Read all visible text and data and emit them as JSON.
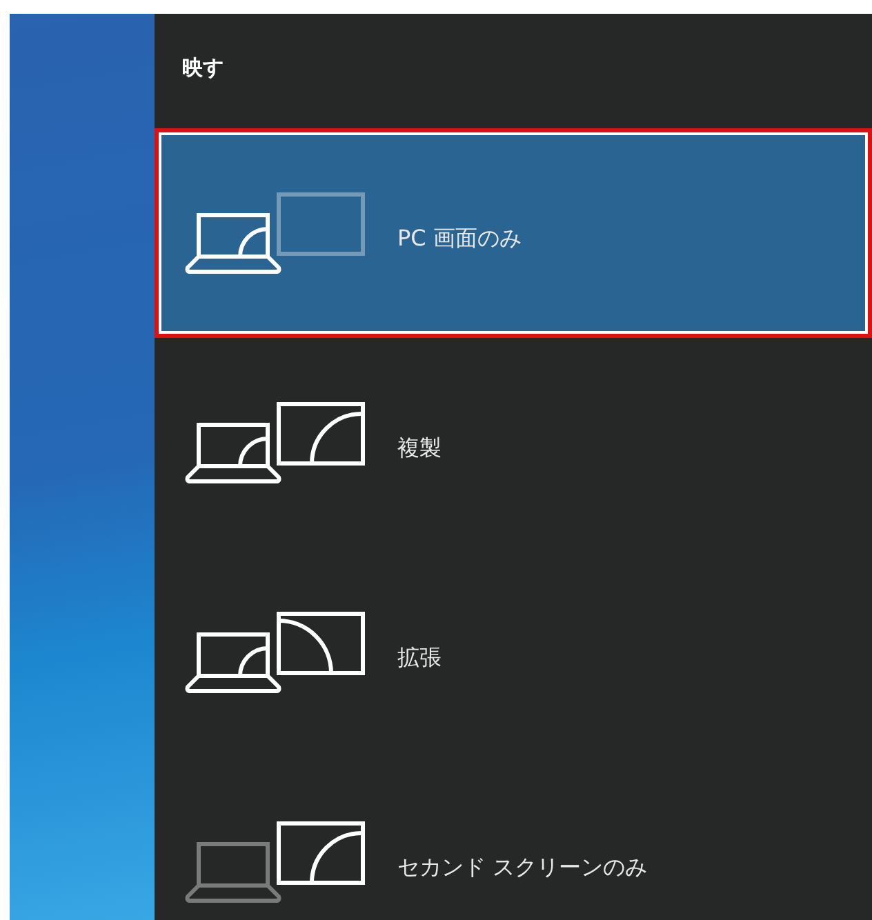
{
  "panel": {
    "title": "映す",
    "options": [
      {
        "label": "PC 画面のみ",
        "kind": "pc_only",
        "selected": true
      },
      {
        "label": "複製",
        "kind": "duplicate",
        "selected": false
      },
      {
        "label": "拡張",
        "kind": "extend",
        "selected": false
      },
      {
        "label": "セカンド スクリーンのみ",
        "kind": "second_only",
        "selected": false
      }
    ]
  }
}
